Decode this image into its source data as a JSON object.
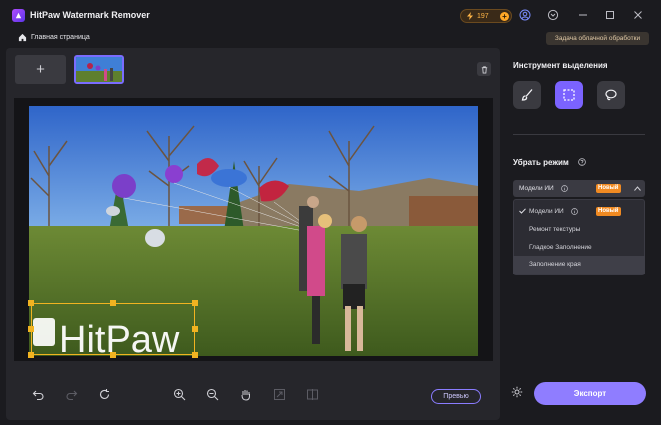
{
  "app": {
    "title": "HitPaw Watermark Remover",
    "credits": "197"
  },
  "titlebar": {
    "icons": [
      "lightning-icon",
      "add-credits-icon",
      "account-icon",
      "settings-icon",
      "minimize-icon",
      "maximize-icon",
      "close-icon"
    ]
  },
  "breadcrumb": {
    "home_label": "Главная страница",
    "cloud_task_label": "Задача облачной обработки"
  },
  "thumbnails": {
    "add_label": "+"
  },
  "watermark": {
    "text": "HitPaw"
  },
  "toolbar": {
    "tools": [
      "undo-icon",
      "redo-icon",
      "reset-icon",
      "zoom-in-icon",
      "zoom-out-icon",
      "hand-icon",
      "fit-icon",
      "compare-icon"
    ],
    "preview_label": "Превью"
  },
  "panel": {
    "selection_tool_title": "Инструмент выделения",
    "selection_tools": [
      "brush-icon",
      "rectangle-select-icon",
      "lasso-icon"
    ],
    "remove_mode_title": "Убрать режим",
    "dropdown_value": "Модели ИИ",
    "new_badge": "Новый",
    "menu_items": [
      {
        "label": "Модели ИИ",
        "checked": true,
        "badge": "Новый"
      },
      {
        "label": "Ремонт текстуры"
      },
      {
        "label": "Гладкое Заполнение"
      },
      {
        "label": "Заполнение края"
      }
    ],
    "export_label": "Экспорт"
  },
  "colors": {
    "accent": "#8f7dff",
    "selection": "#f1b321",
    "badge": "#f08a22"
  }
}
